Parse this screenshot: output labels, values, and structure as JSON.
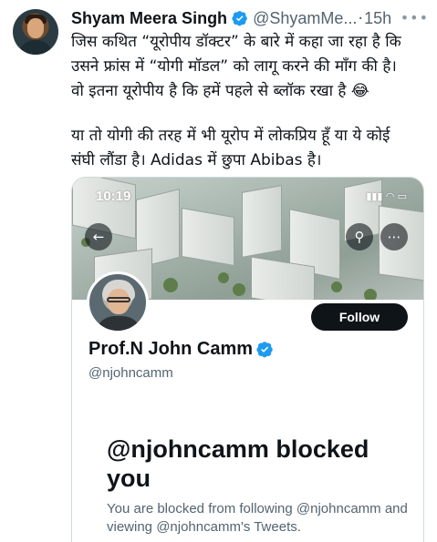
{
  "tweet": {
    "author_name": "Shyam Meera Singh",
    "author_handle": "@ShyamMe...",
    "separator": "·",
    "timestamp": "15h",
    "more_label": "•••",
    "text_lines": [
      "जिस कथित “यूरोपीय डॉक्टर” के बारे में कहा जा रहा है कि",
      "उसने फ्रांस में “योगी मॉडल” को लागू करने की माँग की है।",
      "वो इतना यूरोपीय है कि हमें पहले से ब्लॉक रखा है 😂",
      "या तो योगी की तरह में भी यूरोप में लोकप्रिय हूँ या ये कोई",
      "संघी लौंडा है। Adidas में छुपा Abibas है।"
    ]
  },
  "embedded": {
    "status_time": "10:19",
    "status_icons": "▮▮▮ ◠ ▭",
    "back_icon_glyph": "←",
    "search_icon_glyph": "⚲",
    "more_icon_glyph": "⋯",
    "follow_label": "Follow",
    "profile_name": "Prof.N John Camm",
    "profile_handle": "@njohncamm",
    "blocked_title": "@njohncamm blocked you",
    "blocked_description": "You are blocked from following @njohncamm and viewing @njohncamm's Tweets."
  },
  "colors": {
    "verified_blue": "#1d9bf0",
    "text_primary": "#0f1419",
    "text_secondary": "#536471",
    "follow_bg": "#0f1419"
  }
}
